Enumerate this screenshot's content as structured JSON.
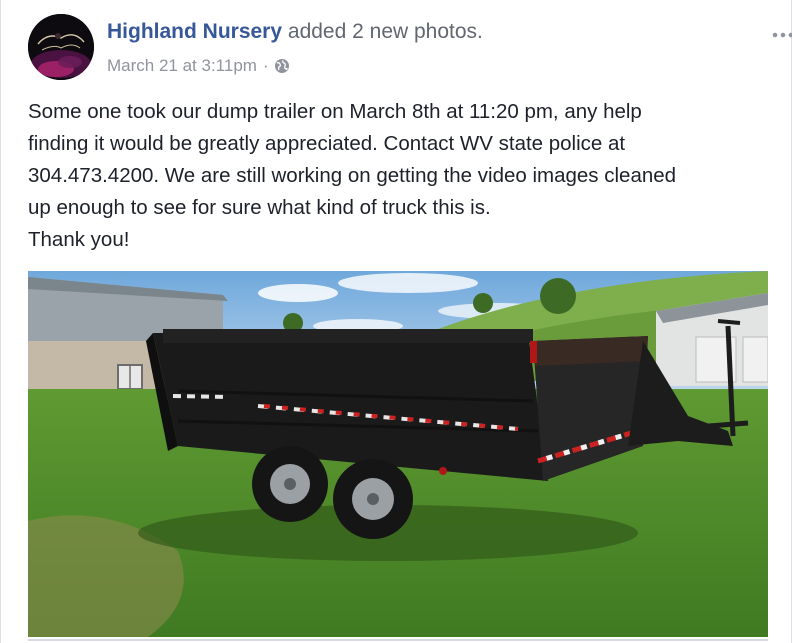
{
  "post": {
    "author": "Highland Nursery",
    "action": "added 2 new photos.",
    "timestamp": "March 21 at 3:11pm",
    "separator": "·",
    "privacy_icon": "globe-icon",
    "menu_icon": "more-options-icon",
    "text_lines": [
      "Some one took our dump trailer on March 8th at 11:20 pm, any help",
      "finding it would be greatly appreciated. Contact WV state police at",
      "304.473.4200. We are still working on getting the video images cleaned",
      "up enough to see for sure what kind of truck this is.",
      "Thank you!"
    ]
  },
  "colors": {
    "author_link": "#365899",
    "secondary_text": "#90949c",
    "body_text": "#1d2129"
  }
}
